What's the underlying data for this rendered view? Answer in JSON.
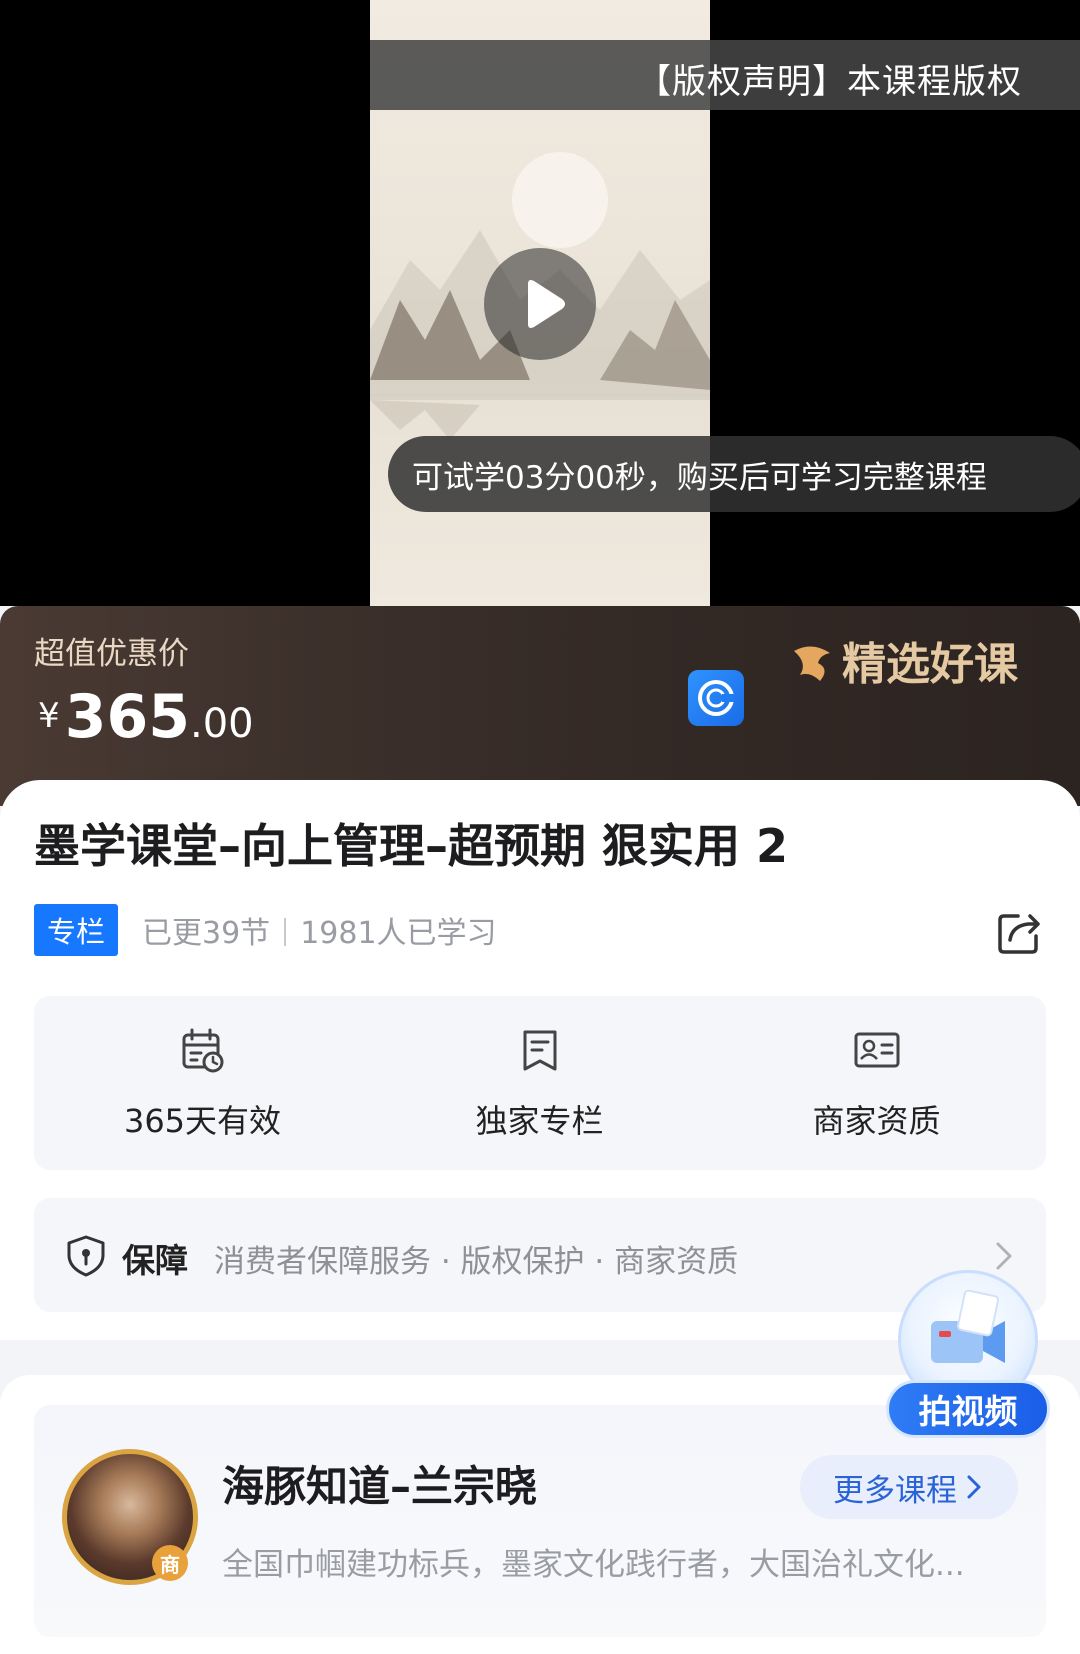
{
  "video": {
    "copyright_text": "【版权声明】本课程版权",
    "trial_text": "可试学03分00秒，购买后可学习完整课程",
    "play_icon": "play-icon"
  },
  "price_banner": {
    "deal_label": "超值优惠价",
    "currency": "¥",
    "price_int": "365",
    "price_dec": ".00",
    "brand": "精选好课",
    "brand_color": "#e5c9a3"
  },
  "course": {
    "title": "墨学课堂–向上管理–超预期 狠实用 2",
    "tag": "专栏",
    "updated": "已更39节",
    "learners": "1981人已学习",
    "accent": "#1677ff"
  },
  "features": [
    {
      "label": "365天有效",
      "icon": "calendar-clock-icon"
    },
    {
      "label": "独家专栏",
      "icon": "bookmark-icon"
    },
    {
      "label": "商家资质",
      "icon": "id-card-icon"
    }
  ],
  "guarantee": {
    "label": "保障",
    "items": "消费者保障服务 · 版权保护 · 商家资质"
  },
  "merchant": {
    "name": "海豚知道–兰宗晓",
    "badge": "商",
    "description": "全国巾帼建功标兵，墨家文化践行者，大国治礼文化...",
    "more_label": "更多课程"
  },
  "float_button": {
    "label": "拍视频"
  }
}
